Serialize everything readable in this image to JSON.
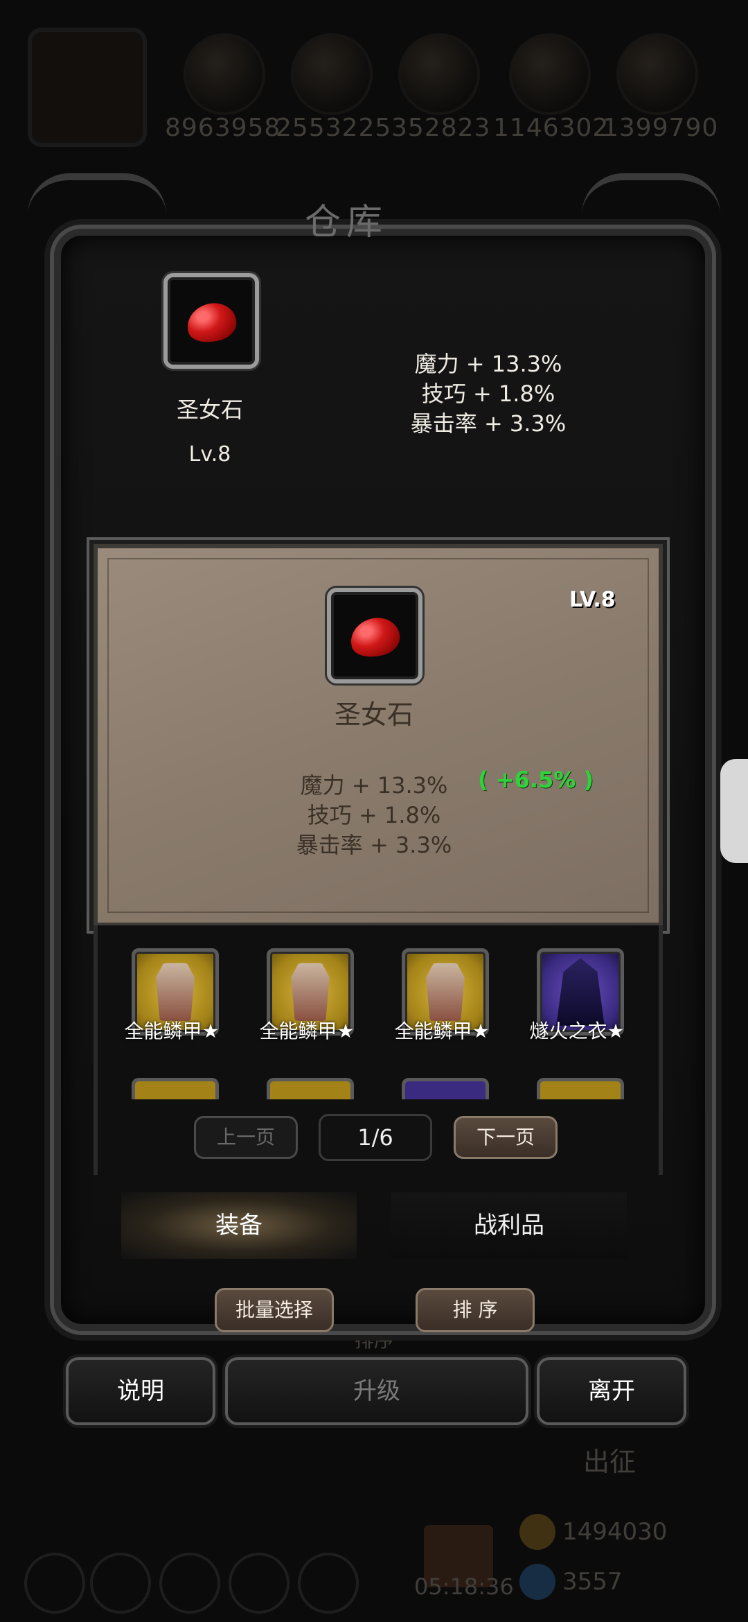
{
  "resources": {
    "values": [
      "8963958",
      "2553225",
      "352823",
      "1146302",
      "1399790"
    ]
  },
  "background": {
    "sort_label": "排序",
    "expedition_label": "出征",
    "gold": "1494030",
    "gems": "3557",
    "timer": "05:18:36"
  },
  "window": {
    "title": "仓库"
  },
  "selected_item": {
    "name": "圣女石",
    "level": "Lv.8",
    "stats": [
      "魔力 + 13.3%",
      "技巧 + 1.8%",
      "暴击率 + 3.3%"
    ]
  },
  "detail": {
    "name": "圣女石",
    "level": "LV.8",
    "stats": [
      "魔力 + 13.3%",
      "技巧 + 1.8%",
      "暴击率 + 3.3%"
    ],
    "bonus": "( +6.5% )",
    "bonus_color": "#2fd23a"
  },
  "grid": {
    "items": [
      {
        "label": "全能鳞甲★",
        "icon": "armor-icon"
      },
      {
        "label": "全能鳞甲★",
        "icon": "armor-icon"
      },
      {
        "label": "全能鳞甲★",
        "icon": "armor-icon"
      },
      {
        "label": "燧火之衣★",
        "icon": "cloak-icon"
      }
    ]
  },
  "pager": {
    "prev": "上一页",
    "page": "1/6",
    "next": "下一页"
  },
  "tabs": {
    "equipment": "装备",
    "loot": "战利品"
  },
  "actions": {
    "batch_select": "批量选择",
    "sort": "排 序",
    "help": "说明",
    "upgrade": "升级",
    "leave": "离开"
  }
}
